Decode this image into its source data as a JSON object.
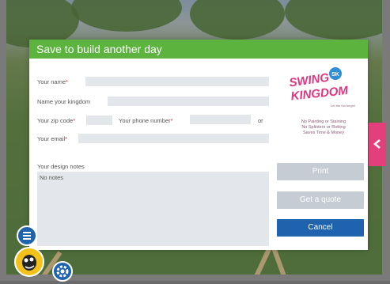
{
  "dialog": {
    "title": "Save to build another day",
    "fields": {
      "name_label": "Your name",
      "kingdom_label": "Name your kingdom",
      "zip_label": "Your zip code",
      "phone_label": "Your phone number",
      "or_text": "or",
      "email_label": "Your email",
      "notes_label": "Your design notes",
      "notes_value": "No notes",
      "required_mark": "*"
    },
    "brand": {
      "logo_text_1": "SWING",
      "logo_text_2": "KINGDOM",
      "logo_badge": "SK",
      "logo_tagline": "Let the fun begin!",
      "tagline_lines": [
        "No Painting or Staining",
        "No Splinters or Rotting",
        "Saves Time & Money"
      ]
    },
    "buttons": {
      "print": "Print",
      "quote": "Get a quote",
      "cancel": "Cancel"
    }
  },
  "colors": {
    "header_green": "#5cb43f",
    "primary_blue": "#1f63ae",
    "side_tab_pink": "#e23f7b",
    "disabled_gray": "#c6ccd4",
    "field_gray": "#e3e6ea",
    "logo_pink": "#e0357f"
  },
  "icons": {
    "side_tab": "chevron-left-icon",
    "menu": "menu-icon",
    "settings": "gear-icon",
    "character": "character-avatar-icon"
  }
}
